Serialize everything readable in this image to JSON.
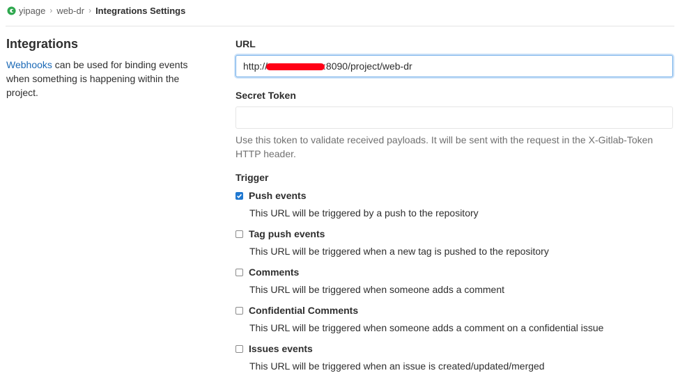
{
  "breadcrumb": {
    "items": [
      "yipage",
      "web-dr"
    ],
    "current": "Integrations Settings"
  },
  "sidebar": {
    "title": "Integrations",
    "link_text": "Webhooks",
    "description": " can be used for binding events when something is happening within the project."
  },
  "form": {
    "url_label": "URL",
    "url_prefix": "http://",
    "url_suffix": ":8090/project/web-dr",
    "secret_label": "Secret Token",
    "secret_value": "",
    "secret_help": "Use this token to validate received payloads. It will be sent with the request in the X-Gitlab-Token HTTP header."
  },
  "trigger": {
    "label": "Trigger",
    "options": [
      {
        "title": "Push events",
        "desc": "This URL will be triggered by a push to the repository",
        "checked": true
      },
      {
        "title": "Tag push events",
        "desc": "This URL will be triggered when a new tag is pushed to the repository",
        "checked": false
      },
      {
        "title": "Comments",
        "desc": "This URL will be triggered when someone adds a comment",
        "checked": false
      },
      {
        "title": "Confidential Comments",
        "desc": "This URL will be triggered when someone adds a comment on a confidential issue",
        "checked": false
      },
      {
        "title": "Issues events",
        "desc": "This URL will be triggered when an issue is created/updated/merged",
        "checked": false
      }
    ]
  },
  "colors": {
    "link": "#1b69b6",
    "checkbox_checked": "#1f78d1",
    "logo": "#2fa84f",
    "redaction": "#ff0016"
  }
}
